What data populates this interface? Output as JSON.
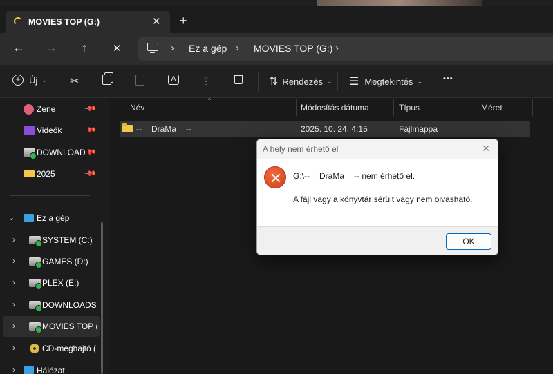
{
  "tab": {
    "title": "MOVIES TOP (G:)",
    "close_glyph": "✕",
    "new_tab_glyph": "+"
  },
  "nav": {
    "back_glyph": "←",
    "forward_glyph": "→",
    "up_glyph": "↑",
    "close_glyph": "✕",
    "breadcrumb": [
      "Ez a gép",
      "MOVIES TOP (G:)"
    ],
    "chevron": "›"
  },
  "commands": {
    "new_label": "Új",
    "sort_label": "Rendezés",
    "view_label": "Megtekintés",
    "more_glyph": "•••",
    "dropdown_glyph": "⌄"
  },
  "sidebar": {
    "quick_access": [
      {
        "label": "Zene",
        "icon": "music-icon",
        "color": "#e0607a"
      },
      {
        "label": "Videók",
        "icon": "video-icon",
        "color": "#8a4fd6"
      },
      {
        "label": "DOWNLOADS",
        "icon": "drive-icon",
        "color": "#bdbdbd"
      },
      {
        "label": "2025",
        "icon": "folder-icon",
        "color": "#f2c84b"
      }
    ],
    "this_pc_label": "Ez a gép",
    "drives": [
      {
        "label": "SYSTEM (C:)"
      },
      {
        "label": "GAMES (D:)"
      },
      {
        "label": "PLEX (E:)"
      },
      {
        "label": "DOWNLOADS"
      },
      {
        "label": "MOVIES TOP (G:)"
      },
      {
        "label": "CD-meghajtó (F:)"
      }
    ],
    "network_label": "Hálózat"
  },
  "columns": {
    "name": "Név",
    "modified": "Módosítás dátuma",
    "type": "Típus",
    "size": "Méret"
  },
  "files": [
    {
      "name": "--==DraMa==--",
      "modified": "2025. 10. 24. 4:15",
      "type": "Fájlmappa",
      "size": ""
    }
  ],
  "dialog": {
    "title": "A hely nem érhető el",
    "close_glyph": "✕",
    "message_path": "G:\\--==DraMa==-- nem érhető el.",
    "message_detail": "A fájl vagy a könyvtár sérült vagy nem olvasható.",
    "ok_label": "OK"
  }
}
